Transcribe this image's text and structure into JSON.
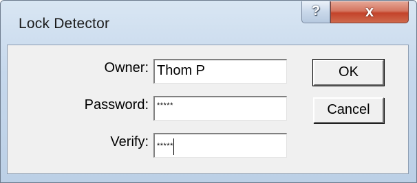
{
  "window": {
    "title": "Lock Detector",
    "help_glyph": "?",
    "close_glyph": "x"
  },
  "form": {
    "owner_label": "Owner:",
    "owner_value": "Thom P",
    "password_label": "Password:",
    "password_value": "*****",
    "verify_label": "Verify:",
    "verify_value": "*****"
  },
  "buttons": {
    "ok_label": "OK",
    "cancel_label": "Cancel"
  }
}
